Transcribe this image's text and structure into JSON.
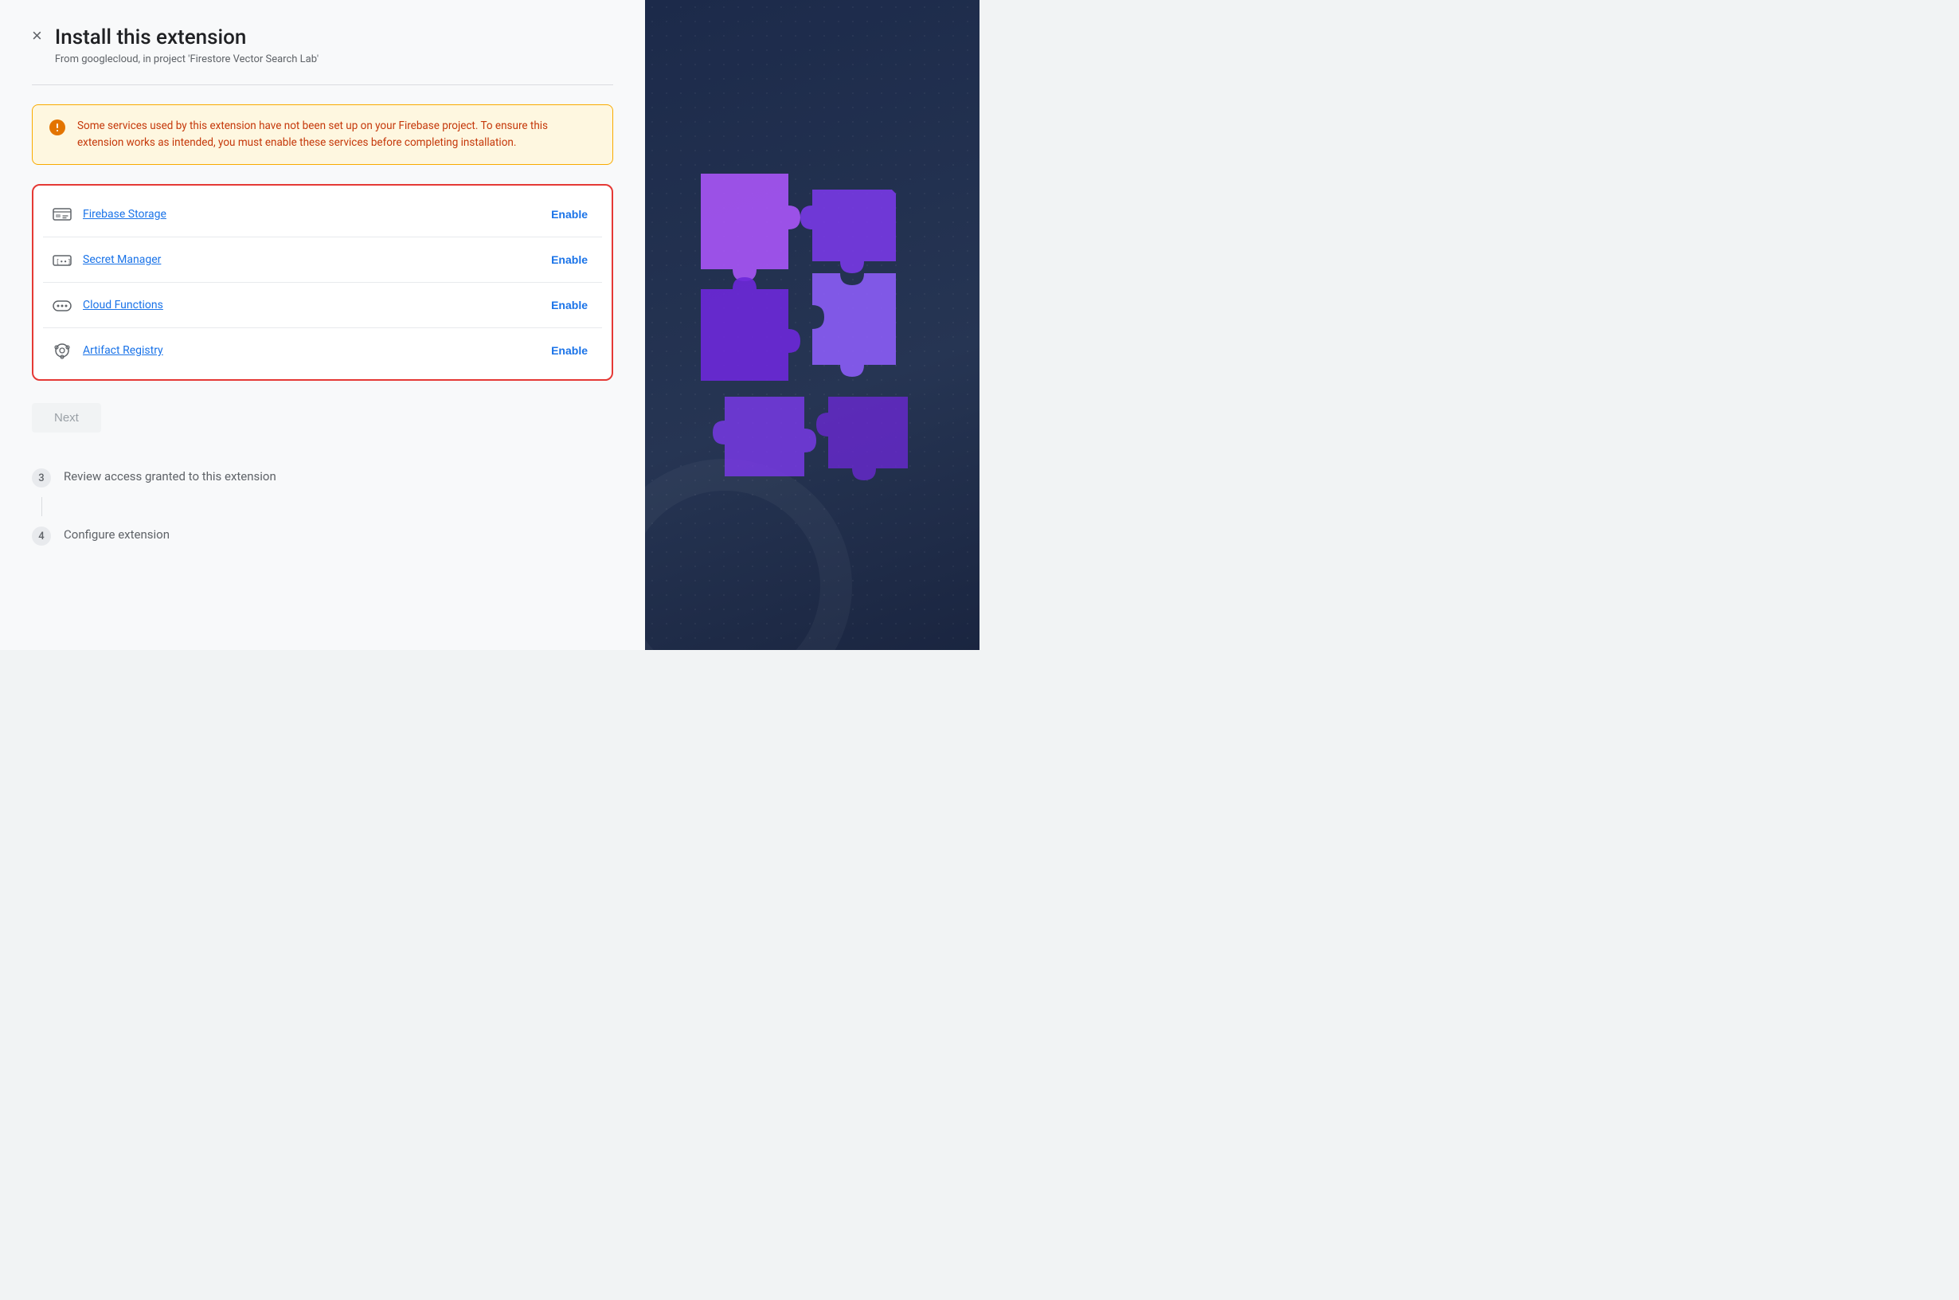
{
  "header": {
    "title": "Install this extension",
    "subtitle": "From googlecloud, in project 'Firestore Vector Search Lab'",
    "close_label": "×"
  },
  "warning": {
    "icon": "⚠",
    "text": "Some services used by this extension have not been set up on your Firebase project. To ensure this extension works as intended, you must enable these services before completing installation."
  },
  "services": [
    {
      "name": "Firebase Storage",
      "icon": "🖼",
      "icon_type": "image",
      "enable_label": "Enable"
    },
    {
      "name": "Secret Manager",
      "icon": "[∙∙]",
      "icon_type": "secret",
      "enable_label": "Enable"
    },
    {
      "name": "Cloud Functions",
      "icon": "(∙∙∙)",
      "icon_type": "functions",
      "enable_label": "Enable"
    },
    {
      "name": "Artifact Registry",
      "icon": "⚙",
      "icon_type": "registry",
      "enable_label": "Enable"
    }
  ],
  "next_button": {
    "label": "Next"
  },
  "steps": [
    {
      "number": "3",
      "label": "Review access granted to this extension"
    },
    {
      "number": "4",
      "label": "Configure extension"
    }
  ],
  "colors": {
    "enable_text": "#1a73e8",
    "warning_text": "#c5380a",
    "warning_bg": "#fef7e0",
    "services_border": "#e53935",
    "right_bg_start": "#1c2a4a",
    "right_bg_end": "#1a2540",
    "puzzle_purple_light": "#a855f7",
    "puzzle_purple_dark": "#7c3aed"
  }
}
